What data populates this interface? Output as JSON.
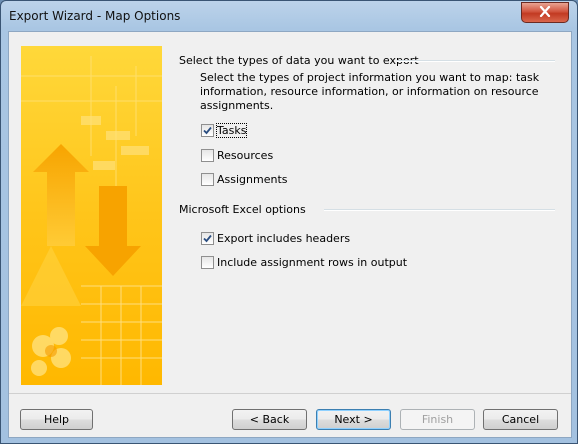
{
  "window": {
    "title": "Export Wizard - Map Options"
  },
  "export_types": {
    "header": "Select the types of data you want to export",
    "description": "Select the types of project information you want to map: task information, resource information, or information on resource assignments.",
    "options": [
      {
        "label": "Tasks",
        "checked": true
      },
      {
        "label": "Resources",
        "checked": false
      },
      {
        "label": "Assignments",
        "checked": false
      }
    ]
  },
  "excel_options": {
    "header": "Microsoft Excel options",
    "options": [
      {
        "label": "Export includes headers",
        "checked": true
      },
      {
        "label": "Include assignment rows in output",
        "checked": false
      }
    ]
  },
  "buttons": {
    "help": "Help",
    "back": "< Back",
    "next": "Next >",
    "finish": "Finish",
    "cancel": "Cancel"
  },
  "colors": {
    "banner_yellow": "#ffc61a",
    "banner_orange": "#f59b00",
    "close_red": "#c8432a"
  }
}
